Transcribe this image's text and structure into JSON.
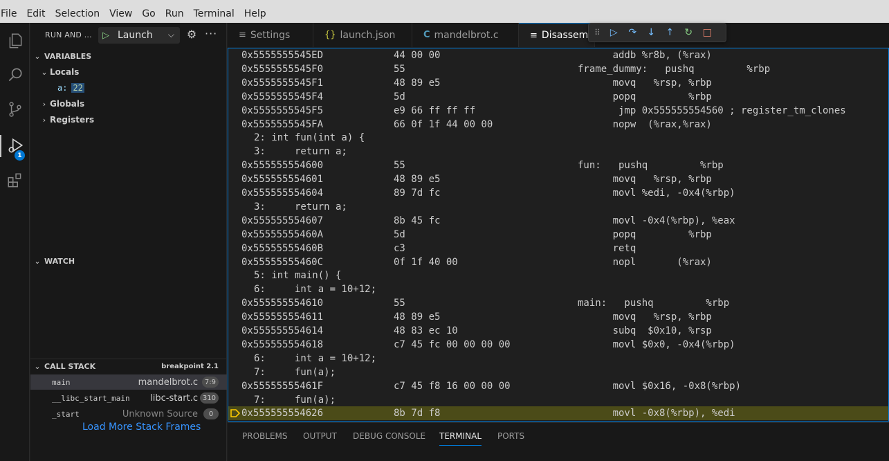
{
  "menu": [
    "File",
    "Edit",
    "Selection",
    "View",
    "Go",
    "Run",
    "Terminal",
    "Help"
  ],
  "activity": {
    "explorer": "files-icon",
    "search": "search-icon",
    "scm": "source-control-icon",
    "debug": "run-debug-icon",
    "debug_badge": "1",
    "extensions": "extensions-icon"
  },
  "sidebar": {
    "title": "RUN AND ...",
    "launch_label": "Launch",
    "variables": {
      "header": "VARIABLES",
      "locals_label": "Locals",
      "var_name": "a:",
      "var_value": "22",
      "globals_label": "Globals",
      "registers_label": "Registers"
    },
    "watch_header": "WATCH",
    "call_stack": {
      "header": "CALL STACK",
      "status": "breakpoint 2.1",
      "frames": [
        {
          "fn": "main",
          "file": "mandelbrot.c",
          "pos": "7:9"
        },
        {
          "fn": "__libc_start_main",
          "file": "libc-start.c",
          "pos": "310"
        },
        {
          "fn": "_start",
          "file": "Unknown Source",
          "pos": "0"
        }
      ],
      "load_more": "Load More Stack Frames"
    }
  },
  "tabs": [
    {
      "icon": "≡",
      "label": "Settings"
    },
    {
      "icon": "{}",
      "label": "launch.json"
    },
    {
      "icon": "C",
      "label": "mandelbrot.c"
    },
    {
      "icon": "≡",
      "label": "Disassem"
    }
  ],
  "disassembly": [
    {
      "addr": "0x5555555545ED",
      "bytes": "44 00 00",
      "instr": "      addb %r8b, (%rax)"
    },
    {
      "addr": "0x5555555545F0",
      "bytes": "55",
      "instr": "frame_dummy:   pushq         %rbp"
    },
    {
      "addr": "0x5555555545F1",
      "bytes": "48 89 e5",
      "instr": "      movq   %rsp, %rbp"
    },
    {
      "addr": "0x5555555545F4",
      "bytes": "5d",
      "instr": "      popq         %rbp"
    },
    {
      "addr": "0x5555555545F5",
      "bytes": "e9 66 ff ff ff",
      "instr": "       jmp 0x555555554560 ; register_tm_clones"
    },
    {
      "addr": "0x5555555545FA",
      "bytes": "66 0f 1f 44 00 00",
      "instr": "      nopw  (%rax,%rax)"
    },
    {
      "src": "2: int fun(int a) {"
    },
    {
      "src": "3:     return a;"
    },
    {
      "addr": "0x555555554600",
      "bytes": "55",
      "instr": "fun:   pushq         %rbp"
    },
    {
      "addr": "0x555555554601",
      "bytes": "48 89 e5",
      "instr": "      movq   %rsp, %rbp"
    },
    {
      "addr": "0x555555554604",
      "bytes": "89 7d fc",
      "instr": "      movl %edi, -0x4(%rbp)"
    },
    {
      "src": "3:     return a;"
    },
    {
      "addr": "0x555555554607",
      "bytes": "8b 45 fc",
      "instr": "      movl -0x4(%rbp), %eax"
    },
    {
      "addr": "0x55555555460A",
      "bytes": "5d",
      "instr": "      popq         %rbp"
    },
    {
      "addr": "0x55555555460B",
      "bytes": "c3",
      "instr": "      retq"
    },
    {
      "addr": "0x55555555460C",
      "bytes": "0f 1f 40 00",
      "instr": "      nopl       (%rax)"
    },
    {
      "src": "5: int main() {"
    },
    {
      "src": "6:     int a = 10+12;"
    },
    {
      "addr": "0x555555554610",
      "bytes": "55",
      "instr": "main:   pushq         %rbp"
    },
    {
      "addr": "0x555555554611",
      "bytes": "48 89 e5",
      "instr": "      movq   %rsp, %rbp"
    },
    {
      "addr": "0x555555554614",
      "bytes": "48 83 ec 10",
      "instr": "      subq  $0x10, %rsp"
    },
    {
      "addr": "0x555555554618",
      "bytes": "c7 45 fc 00 00 00 00",
      "instr": "      movl $0x0, -0x4(%rbp)"
    },
    {
      "src": "6:     int a = 10+12;"
    },
    {
      "src": "7:     fun(a);"
    },
    {
      "addr": "0x55555555461F",
      "bytes": "c7 45 f8 16 00 00 00",
      "instr": "      movl $0x16, -0x8(%rbp)"
    },
    {
      "src": "7:     fun(a);"
    },
    {
      "addr": "0x555555554626",
      "bytes": "8b 7d f8",
      "instr": "      movl -0x8(%rbp), %edi",
      "current": true
    }
  ],
  "panel": {
    "tabs": [
      "PROBLEMS",
      "OUTPUT",
      "DEBUG CONSOLE",
      "TERMINAL",
      "PORTS"
    ],
    "active": "TERMINAL"
  },
  "colors": {
    "accent": "#0078d4",
    "current_line": "#4b4b18",
    "play": "#89d185",
    "stop": "#f48771"
  }
}
